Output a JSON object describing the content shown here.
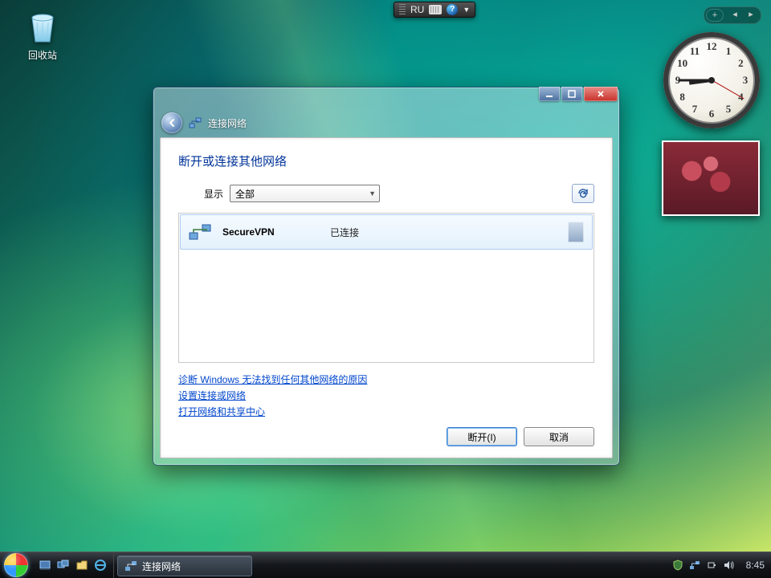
{
  "desktop": {
    "recycle_bin_label": "回收站"
  },
  "langbar": {
    "language": "RU"
  },
  "clock_gadget": {
    "hour": 8,
    "minute": 45,
    "second": 20,
    "numerals": [
      "12",
      "1",
      "2",
      "3",
      "4",
      "5",
      "6",
      "7",
      "8",
      "9",
      "10",
      "11"
    ]
  },
  "window": {
    "title": "连接网络",
    "heading": "断开或连接其他网络",
    "filter_label": "显示",
    "filter_value": "全部",
    "network": {
      "name": "SecureVPN",
      "status": "已连接"
    },
    "links": {
      "diagnose": "诊断 Windows 无法找到任何其他网络的原因",
      "setup": "设置连接或网络",
      "open_center": "打开网络和共享中心"
    },
    "buttons": {
      "disconnect": "断开(I)",
      "cancel": "取消"
    }
  },
  "taskbar": {
    "task_label": "连接网络",
    "time": "8:45"
  }
}
